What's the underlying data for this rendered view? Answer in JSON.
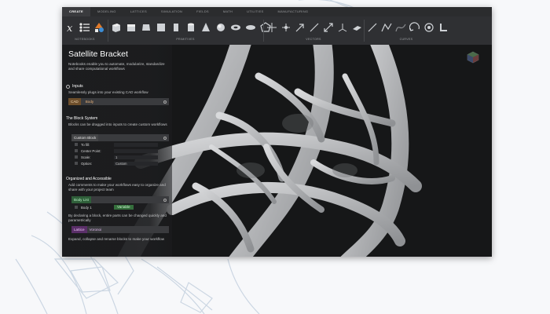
{
  "tabs": [
    "CREATE",
    "MODELING",
    "LATTICES",
    "SIMULATION",
    "FIELDS",
    "MATH",
    "UTILITIES",
    "MANUFACTURING"
  ],
  "toolbar": {
    "groups": {
      "notebooks": "NOTEBOOKS",
      "primitives": "PRIMITIVES",
      "vectors": "VECTORS",
      "curves": "CURVES"
    }
  },
  "notebook": {
    "title": "Satellite Bracket",
    "description": "Notebooks enable you to automate, modularize, standardize and share computational workflows"
  },
  "inputs": {
    "heading": "Inputs",
    "text": "Seamlessly plugs into your existing CAD workflow",
    "block_tag": "CAD",
    "block_name": "Body"
  },
  "block_system": {
    "heading": "The Block System",
    "text": "Blocks can be dragged into inputs to create custom workflows",
    "block_name": "Custom Block",
    "rows": [
      {
        "label": "To fill:",
        "value": ""
      },
      {
        "label": "Center Point:",
        "value": ""
      },
      {
        "label": "Scale:",
        "value": "1"
      },
      {
        "label": "Option:",
        "value": "Custom"
      }
    ]
  },
  "organized": {
    "heading": "Organized and Accessible",
    "text": "Add comments to make your workflows easy to organize and share with your project team",
    "list_name": "Body List",
    "list_item": "Body 1",
    "list_item_value": "Variable",
    "text2": "By declaring a block, entire parts can be changed quickly and parametrically",
    "lattice_tag": "Lattice",
    "lattice_name": "Voronoi",
    "text3": "Expand, collapse and rename blocks to make your workflow"
  },
  "colors": {
    "window_bg": "#151617",
    "toolbar_bg": "#2f3033",
    "cad_chip": "#6e4f2c",
    "list_chip": "#2f5f3a",
    "lattice_chip": "#5a2f68"
  }
}
